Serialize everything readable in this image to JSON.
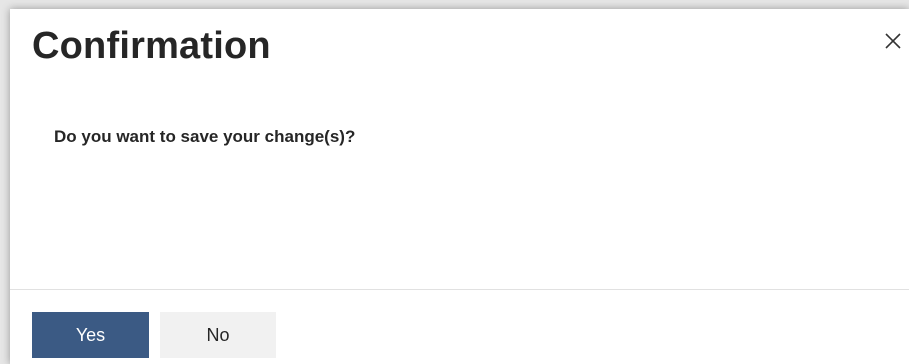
{
  "dialog": {
    "title": "Confirmation",
    "message": "Do you want to save your change(s)?",
    "close_icon": "close-icon",
    "buttons": {
      "yes_label": "Yes",
      "no_label": "No"
    }
  },
  "colors": {
    "primary_button": "#3b5a84",
    "secondary_button": "#f1f1f1",
    "text": "#262626"
  }
}
